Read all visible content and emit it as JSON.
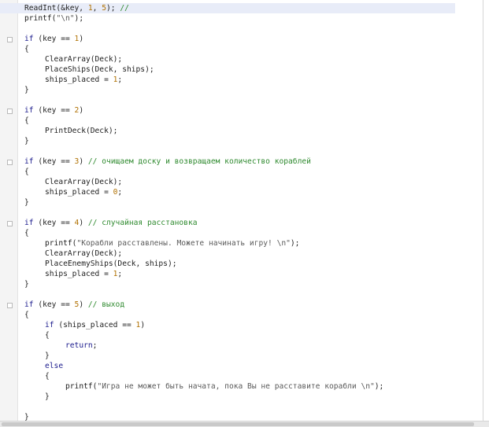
{
  "editor": {
    "lines": [
      {
        "indent": 0,
        "tokens": [
          {
            "t": "fn",
            "v": "ReadInt(&key, "
          },
          {
            "t": "num",
            "v": "1"
          },
          {
            "t": "fn",
            "v": ", "
          },
          {
            "t": "num",
            "v": "5"
          },
          {
            "t": "fn",
            "v": "); "
          },
          {
            "t": "cm",
            "v": "//"
          }
        ],
        "current": true
      },
      {
        "indent": 0,
        "tokens": [
          {
            "t": "fn",
            "v": "printf("
          },
          {
            "t": "str",
            "v": "\"\\n\""
          },
          {
            "t": "fn",
            "v": ");"
          }
        ]
      },
      {
        "indent": 0,
        "tokens": []
      },
      {
        "indent": 0,
        "tokens": [
          {
            "t": "kw",
            "v": "if"
          },
          {
            "t": "fn",
            "v": " (key == "
          },
          {
            "t": "num",
            "v": "1"
          },
          {
            "t": "fn",
            "v": ")"
          }
        ],
        "fold": true
      },
      {
        "indent": 0,
        "tokens": [
          {
            "t": "fn",
            "v": "{"
          }
        ]
      },
      {
        "indent": 1,
        "tokens": [
          {
            "t": "fn",
            "v": "ClearArray(Deck);"
          }
        ]
      },
      {
        "indent": 1,
        "tokens": [
          {
            "t": "fn",
            "v": "PlaceShips(Deck, ships);"
          }
        ]
      },
      {
        "indent": 1,
        "tokens": [
          {
            "t": "fn",
            "v": "ships_placed = "
          },
          {
            "t": "num",
            "v": "1"
          },
          {
            "t": "fn",
            "v": ";"
          }
        ]
      },
      {
        "indent": 0,
        "tokens": [
          {
            "t": "fn",
            "v": "}"
          }
        ]
      },
      {
        "indent": 0,
        "tokens": []
      },
      {
        "indent": 0,
        "tokens": [
          {
            "t": "kw",
            "v": "if"
          },
          {
            "t": "fn",
            "v": " (key == "
          },
          {
            "t": "num",
            "v": "2"
          },
          {
            "t": "fn",
            "v": ")"
          }
        ],
        "fold": true
      },
      {
        "indent": 0,
        "tokens": [
          {
            "t": "fn",
            "v": "{"
          }
        ]
      },
      {
        "indent": 1,
        "tokens": [
          {
            "t": "fn",
            "v": "PrintDeck(Deck);"
          }
        ]
      },
      {
        "indent": 0,
        "tokens": [
          {
            "t": "fn",
            "v": "}"
          }
        ]
      },
      {
        "indent": 0,
        "tokens": []
      },
      {
        "indent": 0,
        "tokens": [
          {
            "t": "kw",
            "v": "if"
          },
          {
            "t": "fn",
            "v": " (key == "
          },
          {
            "t": "num",
            "v": "3"
          },
          {
            "t": "fn",
            "v": ") "
          },
          {
            "t": "cm",
            "v": "// очищаем доску и возвращаем количество кораблей"
          }
        ],
        "fold": true
      },
      {
        "indent": 0,
        "tokens": [
          {
            "t": "fn",
            "v": "{"
          }
        ]
      },
      {
        "indent": 1,
        "tokens": [
          {
            "t": "fn",
            "v": "ClearArray(Deck);"
          }
        ]
      },
      {
        "indent": 1,
        "tokens": [
          {
            "t": "fn",
            "v": "ships_placed = "
          },
          {
            "t": "num",
            "v": "0"
          },
          {
            "t": "fn",
            "v": ";"
          }
        ]
      },
      {
        "indent": 0,
        "tokens": [
          {
            "t": "fn",
            "v": "}"
          }
        ]
      },
      {
        "indent": 0,
        "tokens": []
      },
      {
        "indent": 0,
        "tokens": [
          {
            "t": "kw",
            "v": "if"
          },
          {
            "t": "fn",
            "v": " (key == "
          },
          {
            "t": "num",
            "v": "4"
          },
          {
            "t": "fn",
            "v": ") "
          },
          {
            "t": "cm",
            "v": "// случайная расстановка"
          }
        ],
        "fold": true
      },
      {
        "indent": 0,
        "tokens": [
          {
            "t": "fn",
            "v": "{"
          }
        ]
      },
      {
        "indent": 1,
        "tokens": [
          {
            "t": "fn",
            "v": "printf("
          },
          {
            "t": "str",
            "v": "\"Корабли расставлены. Можете начинать игру! \\n\""
          },
          {
            "t": "fn",
            "v": ");"
          }
        ]
      },
      {
        "indent": 1,
        "tokens": [
          {
            "t": "fn",
            "v": "ClearArray(Deck);"
          }
        ]
      },
      {
        "indent": 1,
        "tokens": [
          {
            "t": "fn",
            "v": "PlaceEnemyShips(Deck, ships);"
          }
        ]
      },
      {
        "indent": 1,
        "tokens": [
          {
            "t": "fn",
            "v": "ships_placed = "
          },
          {
            "t": "num",
            "v": "1"
          },
          {
            "t": "fn",
            "v": ";"
          }
        ]
      },
      {
        "indent": 0,
        "tokens": [
          {
            "t": "fn",
            "v": "}"
          }
        ]
      },
      {
        "indent": 0,
        "tokens": []
      },
      {
        "indent": 0,
        "tokens": [
          {
            "t": "kw",
            "v": "if"
          },
          {
            "t": "fn",
            "v": " (key == "
          },
          {
            "t": "num",
            "v": "5"
          },
          {
            "t": "fn",
            "v": ") "
          },
          {
            "t": "cm",
            "v": "// выход"
          }
        ],
        "fold": true
      },
      {
        "indent": 0,
        "tokens": [
          {
            "t": "fn",
            "v": "{"
          }
        ]
      },
      {
        "indent": 1,
        "tokens": [
          {
            "t": "kw",
            "v": "if"
          },
          {
            "t": "fn",
            "v": " (ships_placed == "
          },
          {
            "t": "num",
            "v": "1"
          },
          {
            "t": "fn",
            "v": ")"
          }
        ]
      },
      {
        "indent": 1,
        "tokens": [
          {
            "t": "fn",
            "v": "{"
          }
        ]
      },
      {
        "indent": 2,
        "tokens": [
          {
            "t": "kw",
            "v": "return"
          },
          {
            "t": "fn",
            "v": ";"
          }
        ]
      },
      {
        "indent": 1,
        "tokens": [
          {
            "t": "fn",
            "v": "}"
          }
        ]
      },
      {
        "indent": 1,
        "tokens": [
          {
            "t": "kw",
            "v": "else"
          }
        ]
      },
      {
        "indent": 1,
        "tokens": [
          {
            "t": "fn",
            "v": "{"
          }
        ]
      },
      {
        "indent": 2,
        "tokens": [
          {
            "t": "fn",
            "v": "printf("
          },
          {
            "t": "str",
            "v": "\"Игра не может быть начата, пока Вы не расставите корабли \\n\""
          },
          {
            "t": "fn",
            "v": ");"
          }
        ]
      },
      {
        "indent": 1,
        "tokens": [
          {
            "t": "fn",
            "v": "}"
          }
        ]
      },
      {
        "indent": 0,
        "tokens": []
      },
      {
        "indent": 0,
        "tokens": [
          {
            "t": "fn",
            "v": "}"
          }
        ]
      }
    ]
  },
  "colors": {
    "keyword": "#1a1a8c",
    "number": "#b07000",
    "string": "#5a5a5a",
    "comment": "#2f8a2f",
    "current_line": "#e8ecf8"
  }
}
